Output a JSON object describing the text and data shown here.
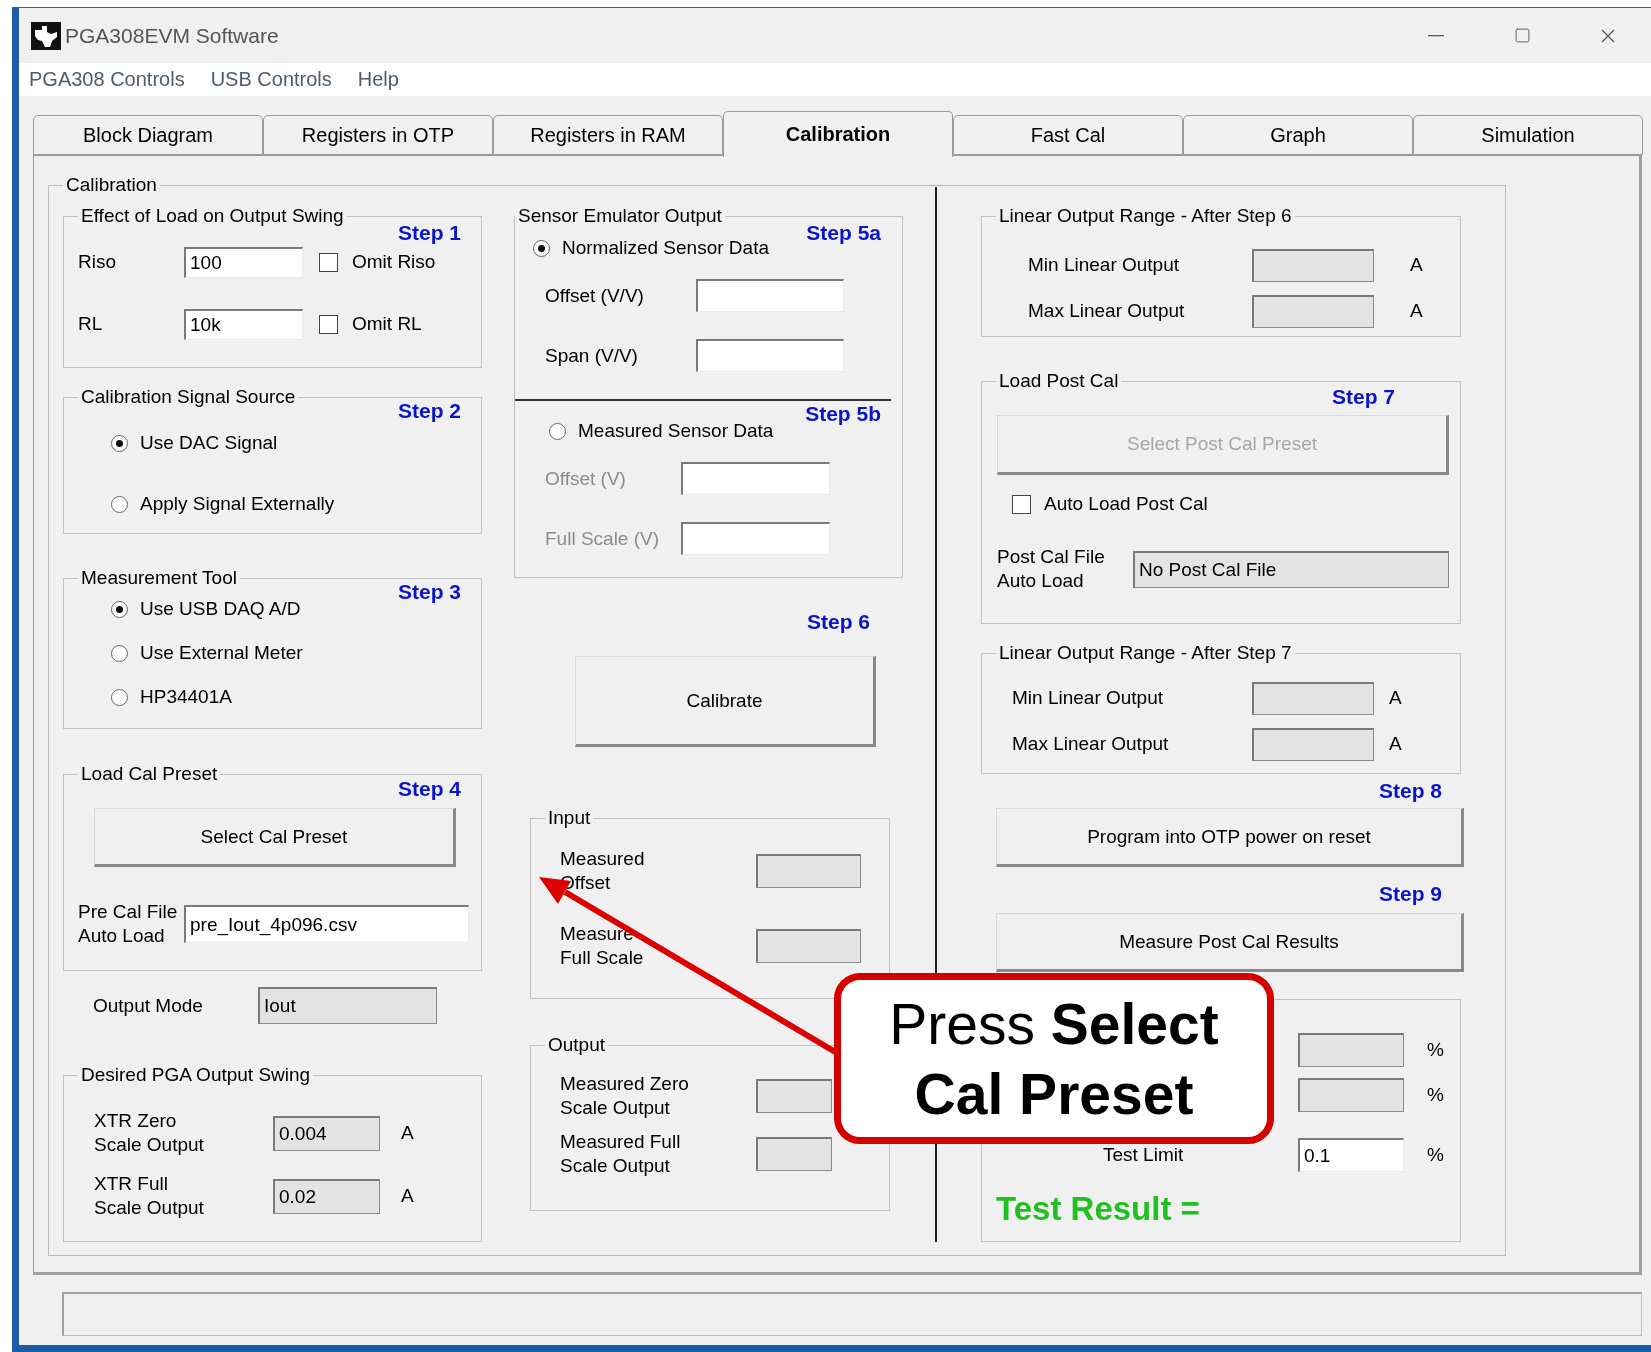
{
  "window": {
    "title": "PGA308EVM Software"
  },
  "menu": [
    "PGA308 Controls",
    "USB Controls",
    "Help"
  ],
  "tabs": [
    {
      "label": "Block Diagram",
      "selected": false
    },
    {
      "label": "Registers in OTP",
      "selected": false
    },
    {
      "label": "Registers in RAM",
      "selected": false
    },
    {
      "label": "Calibration",
      "selected": true
    },
    {
      "label": "Fast Cal",
      "selected": false
    },
    {
      "label": "Graph",
      "selected": false
    },
    {
      "label": "Simulation",
      "selected": false
    }
  ],
  "calibration": {
    "title": "Calibration",
    "load_effect": {
      "title": "Effect of Load on Output Swing",
      "step": "Step 1",
      "rows": [
        {
          "label": "Riso",
          "value": "100",
          "editable": true,
          "option": "Omit Riso",
          "checked": false
        },
        {
          "label": "RL",
          "value": "10k",
          "editable": true,
          "option": "Omit RL",
          "checked": false
        }
      ]
    },
    "signal_source": {
      "title": "Calibration Signal Source",
      "step": "Step 2",
      "options": [
        {
          "label": "Use DAC Signal",
          "selected": true
        },
        {
          "label": "Apply Signal Externally",
          "selected": false
        }
      ]
    },
    "measurement_tool": {
      "title": "Measurement Tool",
      "step": "Step 3",
      "options": [
        {
          "label": "Use USB DAQ A/D",
          "selected": true
        },
        {
          "label": "Use External Meter",
          "selected": false
        },
        {
          "label": "HP34401A",
          "selected": false
        }
      ]
    },
    "load_cal_preset": {
      "title": "Load Cal Preset",
      "step": "Step 4",
      "button": "Select Cal Preset",
      "file": {
        "label": "Pre Cal File\nAuto Load",
        "value": "pre_Iout_4p096.csv",
        "editable": true
      }
    },
    "output_mode": {
      "label": "Output Mode",
      "value": "Iout",
      "editable": false
    },
    "desired_swing": {
      "title": "Desired PGA Output Swing",
      "rows": [
        {
          "label": "XTR Zero\nScale Output",
          "value": "0.004",
          "editable": false,
          "unit": "A"
        },
        {
          "label": "XTR Full\nScale Output",
          "value": "0.02",
          "editable": false,
          "unit": "A"
        }
      ]
    },
    "sensor_emulator": {
      "title": "Sensor Emulator Output",
      "sections": [
        {
          "step": "Step 5a",
          "label": "Normalized Sensor Data",
          "selected": true,
          "fields": [
            {
              "label": "Offset (V/V)",
              "editable": true
            },
            {
              "label": "Span (V/V)",
              "editable": true
            }
          ]
        },
        {
          "step": "Step 5b",
          "label": "Measured Sensor Data",
          "selected": false,
          "fields": [
            {
              "label": "Offset (V)",
              "editable": true
            },
            {
              "label": "Full Scale (V)",
              "editable": true
            }
          ]
        }
      ]
    },
    "calibrate": {
      "step": "Step 6",
      "button": "Calibrate"
    },
    "input": {
      "title": "Input",
      "rows": [
        {
          "label": "Measured\nOffset",
          "editable": false
        },
        {
          "label": "Measure\nFull Scale",
          "editable": false
        }
      ]
    },
    "output": {
      "title": "Output",
      "rows": [
        {
          "label": "Measured Zero\nScale Output",
          "editable": false
        },
        {
          "label": "Measured Full\nScale Output",
          "editable": false
        }
      ]
    },
    "range_after_6": {
      "title": "Linear Output Range - After Step 6",
      "rows": [
        {
          "label": "Min Linear Output",
          "editable": false,
          "unit": "A"
        },
        {
          "label": "Max Linear Output",
          "editable": false,
          "unit": "A"
        }
      ]
    },
    "load_post_cal": {
      "title": "Load Post Cal",
      "step": "Step 7",
      "button": {
        "label": "Select Post Cal Preset",
        "disabled": true
      },
      "auto_load": {
        "label": "Auto Load Post Cal",
        "checked": false
      },
      "file": {
        "label": "Post Cal File\nAuto Load",
        "value": "No Post Cal File",
        "editable": false
      }
    },
    "range_after_7": {
      "title": "Linear Output Range - After Step 7",
      "rows": [
        {
          "label": "Min Linear Output",
          "editable": false,
          "unit": "A"
        },
        {
          "label": "Max Linear Output",
          "editable": false,
          "unit": "A"
        }
      ]
    },
    "program": {
      "step": "Step 8",
      "button": "Program into OTP power on reset"
    },
    "measure": {
      "step": "Step 9",
      "button": "Measure Post Cal Results"
    },
    "results": {
      "rows": [
        {
          "editable": false,
          "unit": "%"
        },
        {
          "editable": false,
          "unit": "%"
        },
        {
          "label": "Test Limit",
          "value": "0.1",
          "editable": true,
          "unit": "%"
        }
      ],
      "result": "Test Result ="
    }
  },
  "callout": {
    "text": "Press **Select Cal Preset**"
  }
}
